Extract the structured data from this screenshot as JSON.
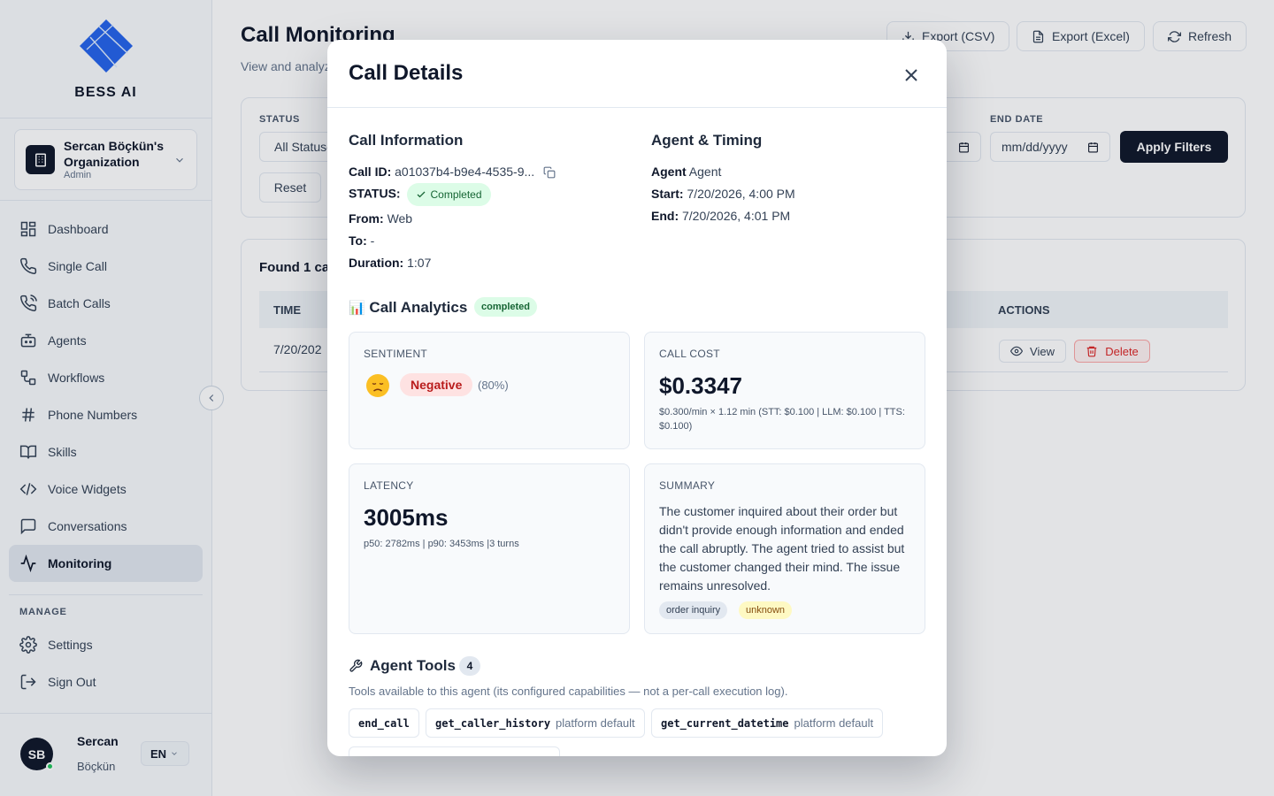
{
  "brand": {
    "name": "BESS AI"
  },
  "org": {
    "name": "Sercan Böçkün's Organization",
    "role": "Admin"
  },
  "nav": {
    "items": [
      {
        "label": "Dashboard"
      },
      {
        "label": "Single Call"
      },
      {
        "label": "Batch Calls"
      },
      {
        "label": "Agents"
      },
      {
        "label": "Workflows"
      },
      {
        "label": "Phone Numbers"
      },
      {
        "label": "Skills"
      },
      {
        "label": "Voice Widgets"
      },
      {
        "label": "Conversations"
      },
      {
        "label": "Monitoring"
      }
    ],
    "active": "Monitoring",
    "manage_label": "MANAGE",
    "manage_items": [
      {
        "label": "Settings"
      },
      {
        "label": "Sign Out"
      }
    ]
  },
  "user": {
    "initials": "SB",
    "first_name": "Sercan",
    "last_name": "Böçkün",
    "lang": "EN"
  },
  "page": {
    "title": "Call Monitoring",
    "subtitle": "View and analyz",
    "export_csv": "Export (CSV)",
    "export_excel": "Export (Excel)",
    "refresh": "Refresh"
  },
  "filters": {
    "status_label": "STATUS",
    "status_value": "All Statuses",
    "end_date_label": "END DATE",
    "date_placeholder": "mm/dd/yyyy",
    "apply": "Apply Filters",
    "reset": "Reset"
  },
  "results": {
    "found": "Found 1 cal",
    "col_time": "TIME",
    "col_actions": "ACTIONS",
    "row_time": "7/20/202",
    "view": "View",
    "delete": "Delete"
  },
  "modal": {
    "title": "Call Details",
    "call_info": {
      "heading": "Call Information",
      "call_id_label": "Call ID:",
      "call_id": "a01037b4-b9e4-4535-9...",
      "status_label": "STATUS:",
      "status": "Completed",
      "from_label": "From:",
      "from": "Web",
      "to_label": "To:",
      "to": "-",
      "duration_label": "Duration:",
      "duration": "1:07"
    },
    "agent_timing": {
      "heading": "Agent & Timing",
      "agent_label": "Agent",
      "agent": "Agent",
      "start_label": "Start:",
      "start": "7/20/2026, 4:00 PM",
      "end_label": "End:",
      "end": "7/20/2026, 4:01 PM"
    },
    "analytics": {
      "heading": "Call Analytics",
      "heading_icon": "📊",
      "badge": "completed",
      "sentiment": {
        "label": "SENTIMENT",
        "emoji": "😞",
        "value": "Negative",
        "confidence": "(80%)"
      },
      "cost": {
        "label": "CALL COST",
        "value": "$0.3347",
        "detail": "$0.300/min × 1.12 min (STT: $0.100 | LLM: $0.100 | TTS: $0.100)"
      },
      "latency": {
        "label": "LATENCY",
        "value": "3005ms",
        "detail": "p50: 2782ms | p90: 3453ms |3 turns"
      },
      "summary": {
        "label": "SUMMARY",
        "text": "The customer inquired about their order but didn't provide enough information and ended the call abruptly. The agent tried to assist but the customer changed their mind. The issue remains unresolved.",
        "tags": [
          "order inquiry",
          "unknown"
        ]
      }
    },
    "tools": {
      "heading": "Agent Tools",
      "count": "4",
      "description": "Tools available to this agent (its configured capabilities — not a per-call execution log).",
      "items": [
        {
          "name": "end_call",
          "note": ""
        },
        {
          "name": "get_caller_history",
          "note": "platform default"
        },
        {
          "name": "get_current_datetime",
          "note": "platform default"
        }
      ]
    }
  }
}
